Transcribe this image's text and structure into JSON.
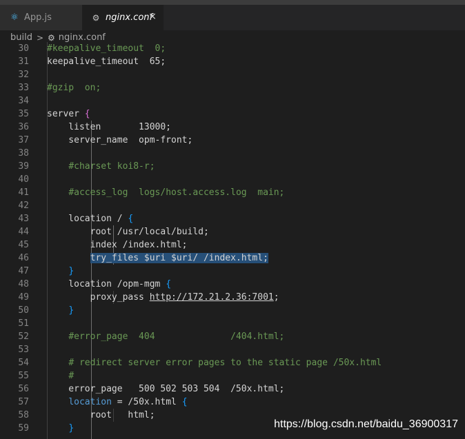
{
  "tabs": [
    {
      "label": "App.js",
      "icon": "react-icon"
    },
    {
      "label": "nginx.conf",
      "icon": "gear-icon",
      "close": "×"
    }
  ],
  "breadcrumb": {
    "folder": "build",
    "separator": ">",
    "file": "nginx.conf"
  },
  "lines": [
    {
      "n": "30",
      "parts": [
        {
          "t": "#keepalive_timeout  0;",
          "c": "comment"
        }
      ]
    },
    {
      "n": "31",
      "parts": [
        {
          "t": "keepalive_timeout  65;"
        }
      ]
    },
    {
      "n": "32",
      "parts": []
    },
    {
      "n": "33",
      "parts": [
        {
          "t": "#gzip  on;",
          "c": "comment"
        }
      ]
    },
    {
      "n": "34",
      "parts": []
    },
    {
      "n": "35",
      "parts": [
        {
          "t": "server "
        },
        {
          "t": "{",
          "c": "brace"
        }
      ]
    },
    {
      "n": "36",
      "parts": [
        {
          "t": "    listen       13000;"
        }
      ]
    },
    {
      "n": "37",
      "parts": [
        {
          "t": "    server_name  opm-front;"
        }
      ]
    },
    {
      "n": "38",
      "parts": []
    },
    {
      "n": "39",
      "parts": [
        {
          "t": "    "
        },
        {
          "t": "#charset koi8-r;",
          "c": "comment"
        }
      ]
    },
    {
      "n": "40",
      "parts": []
    },
    {
      "n": "41",
      "parts": [
        {
          "t": "    "
        },
        {
          "t": "#access_log  logs/host.access.log  main;",
          "c": "comment"
        }
      ]
    },
    {
      "n": "42",
      "parts": []
    },
    {
      "n": "43",
      "parts": [
        {
          "t": "    location / "
        },
        {
          "t": "{",
          "c": "brace2"
        }
      ]
    },
    {
      "n": "44",
      "parts": [
        {
          "t": "        root /usr/local/build;"
        }
      ]
    },
    {
      "n": "45",
      "parts": [
        {
          "t": "        index /index.html;"
        }
      ]
    },
    {
      "n": "46",
      "parts": [
        {
          "t": "        "
        },
        {
          "t": "try_files $uri $uri/ /index.html;",
          "c": "sel"
        }
      ]
    },
    {
      "n": "47",
      "parts": [
        {
          "t": "    "
        },
        {
          "t": "}",
          "c": "brace2"
        }
      ]
    },
    {
      "n": "48",
      "parts": [
        {
          "t": "    location /opm-mgm "
        },
        {
          "t": "{",
          "c": "brace2"
        }
      ]
    },
    {
      "n": "49",
      "parts": [
        {
          "t": "        proxy_pass "
        },
        {
          "t": "http://172.21.2.36:7001",
          "c": "link"
        },
        {
          "t": ";"
        }
      ]
    },
    {
      "n": "50",
      "parts": [
        {
          "t": "    "
        },
        {
          "t": "}",
          "c": "brace2"
        }
      ]
    },
    {
      "n": "51",
      "parts": []
    },
    {
      "n": "52",
      "parts": [
        {
          "t": "    "
        },
        {
          "t": "#error_page  404              /404.html;",
          "c": "comment"
        }
      ]
    },
    {
      "n": "53",
      "parts": []
    },
    {
      "n": "54",
      "parts": [
        {
          "t": "    "
        },
        {
          "t": "# redirect server error pages to the static page /50x.html",
          "c": "comment"
        }
      ]
    },
    {
      "n": "55",
      "parts": [
        {
          "t": "    "
        },
        {
          "t": "#",
          "c": "comment"
        }
      ]
    },
    {
      "n": "56",
      "parts": [
        {
          "t": "    error_page   500 502 503 504  /50x.html;"
        }
      ]
    },
    {
      "n": "57",
      "parts": [
        {
          "t": "    "
        },
        {
          "t": "location",
          "c": "kw"
        },
        {
          "t": " = /50x.html "
        },
        {
          "t": "{",
          "c": "brace2"
        }
      ]
    },
    {
      "n": "58",
      "parts": [
        {
          "t": "        root   html;"
        }
      ]
    },
    {
      "n": "59",
      "parts": [
        {
          "t": "    "
        },
        {
          "t": "}",
          "c": "brace2"
        }
      ]
    }
  ],
  "watermark": "https://blog.csdn.net/baidu_36900317",
  "colors": {
    "comment": "#6a9955",
    "selection": "#264f78",
    "keyword": "#569cd6",
    "brace": "#da70d6"
  }
}
